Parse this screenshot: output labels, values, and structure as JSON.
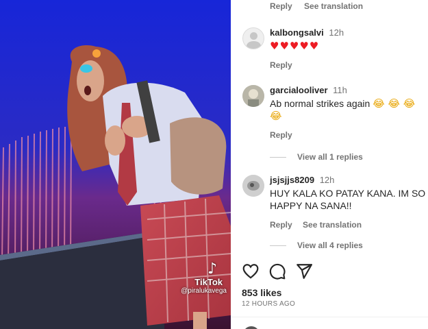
{
  "media": {
    "watermark": {
      "logo_icon": "tiktok-icon",
      "name": "TikTok",
      "user": "@piralukavega"
    }
  },
  "top_row": {
    "reply": "Reply",
    "see_translation": "See translation"
  },
  "comments": [
    {
      "avatar_icon": "default-avatar-icon",
      "user": "kalbongsalvi",
      "time": "12h",
      "text": "♥♥♥♥♥",
      "reply": "Reply"
    },
    {
      "avatar_icon": "user-avatar-photo",
      "user": "garcialooliver",
      "time": "11h",
      "text": "Ab normal strikes again",
      "emoji": "😂 😂 😂 😂",
      "reply": "Reply",
      "view_replies": "View all 1 replies"
    },
    {
      "avatar_icon": "user-avatar-photo",
      "user": "jsjsjjs8209",
      "time": "12h",
      "text": "HUY KALA KO PATAY KANA. IM SO HAPPY NA SANA!!",
      "reply": "Reply",
      "see_translation": "See translation",
      "view_replies": "View all 4 replies"
    }
  ],
  "actions": {
    "like_icon": "heart-icon",
    "comment_icon": "comment-icon",
    "share_icon": "share-icon"
  },
  "likes": "853 likes",
  "time_ago": "12 HOURS AGO",
  "colors": {
    "heart_red": "#ed1c24",
    "muted_text": "#737373",
    "primary_text": "#262626"
  }
}
